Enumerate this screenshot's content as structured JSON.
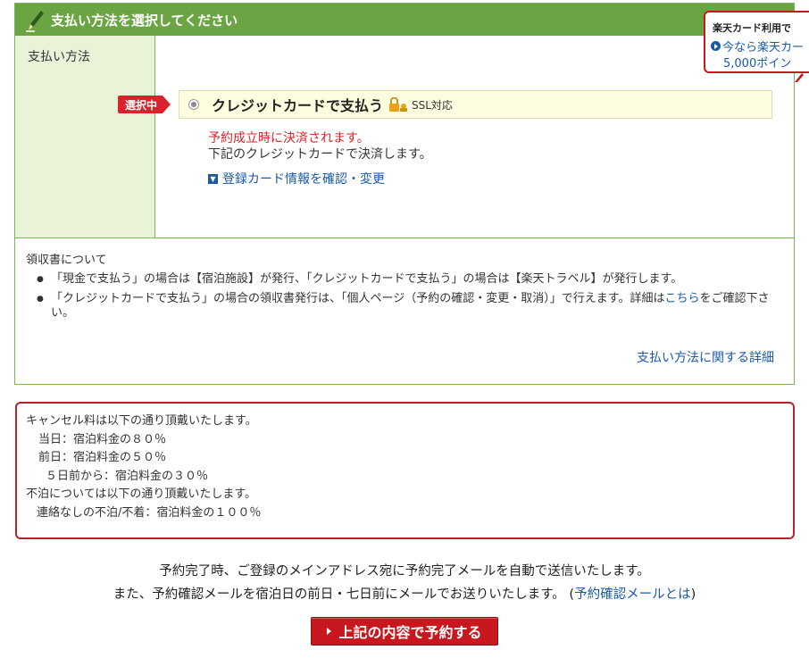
{
  "payment": {
    "header_title": "支払い方法を選択してください",
    "method_label": "支払い方法",
    "selected_tag": "選択中",
    "credit_card_label": "クレジットカードで支払う",
    "ssl_label": "SSL対応",
    "notice_red": "予約成立時に決済されます。",
    "notice_black": "下記のクレジットカードで決済します。",
    "card_info_link": "登録カード情報を確認・変更"
  },
  "receipt": {
    "title": "領収書について",
    "item1": "「現金で支払う」の場合は【宿泊施設】が発行、「クレジットカードで支払う」の場合は【楽天トラベル】が発行します。",
    "item2_pre": "「クレジットカードで支払う」の場合の領収書発行は、「個人ページ（予約の確認・変更・取消）」で行えます。詳細は",
    "item2_link": "こちら",
    "item2_post": "をご確認下さい。",
    "detail_link": "支払い方法に関する詳細"
  },
  "promo": {
    "title": "楽天カード利用で",
    "line1": "今なら楽天カー",
    "line2": "5,000ポイン"
  },
  "cancel": {
    "line1": "キャンセル料は以下の通り頂戴いたします。",
    "line2": "当日：宿泊料金の８０％",
    "line3": "前日：宿泊料金の５０％",
    "line4": "５日前から：宿泊料金の３０％",
    "line5": "不泊については以下の通り頂戴いたします。",
    "line6": "連絡なしの不泊/不着：宿泊料金の１００％"
  },
  "confirm": {
    "line1": "予約完了時、ご登録のメインアドレス宛に予約完了メールを自動で送信いたします。",
    "line2_pre": "また、予約確認メールを宿泊日の前日・七日前にメールでお送りいたします。 (",
    "line2_link": "予約確認メールとは",
    "line2_post": ")"
  },
  "reserve_button": "上記の内容で予約する",
  "colors": {
    "header_green": "#6aa443",
    "accent_red": "#c8171e",
    "link_blue": "#1a5aa8"
  }
}
